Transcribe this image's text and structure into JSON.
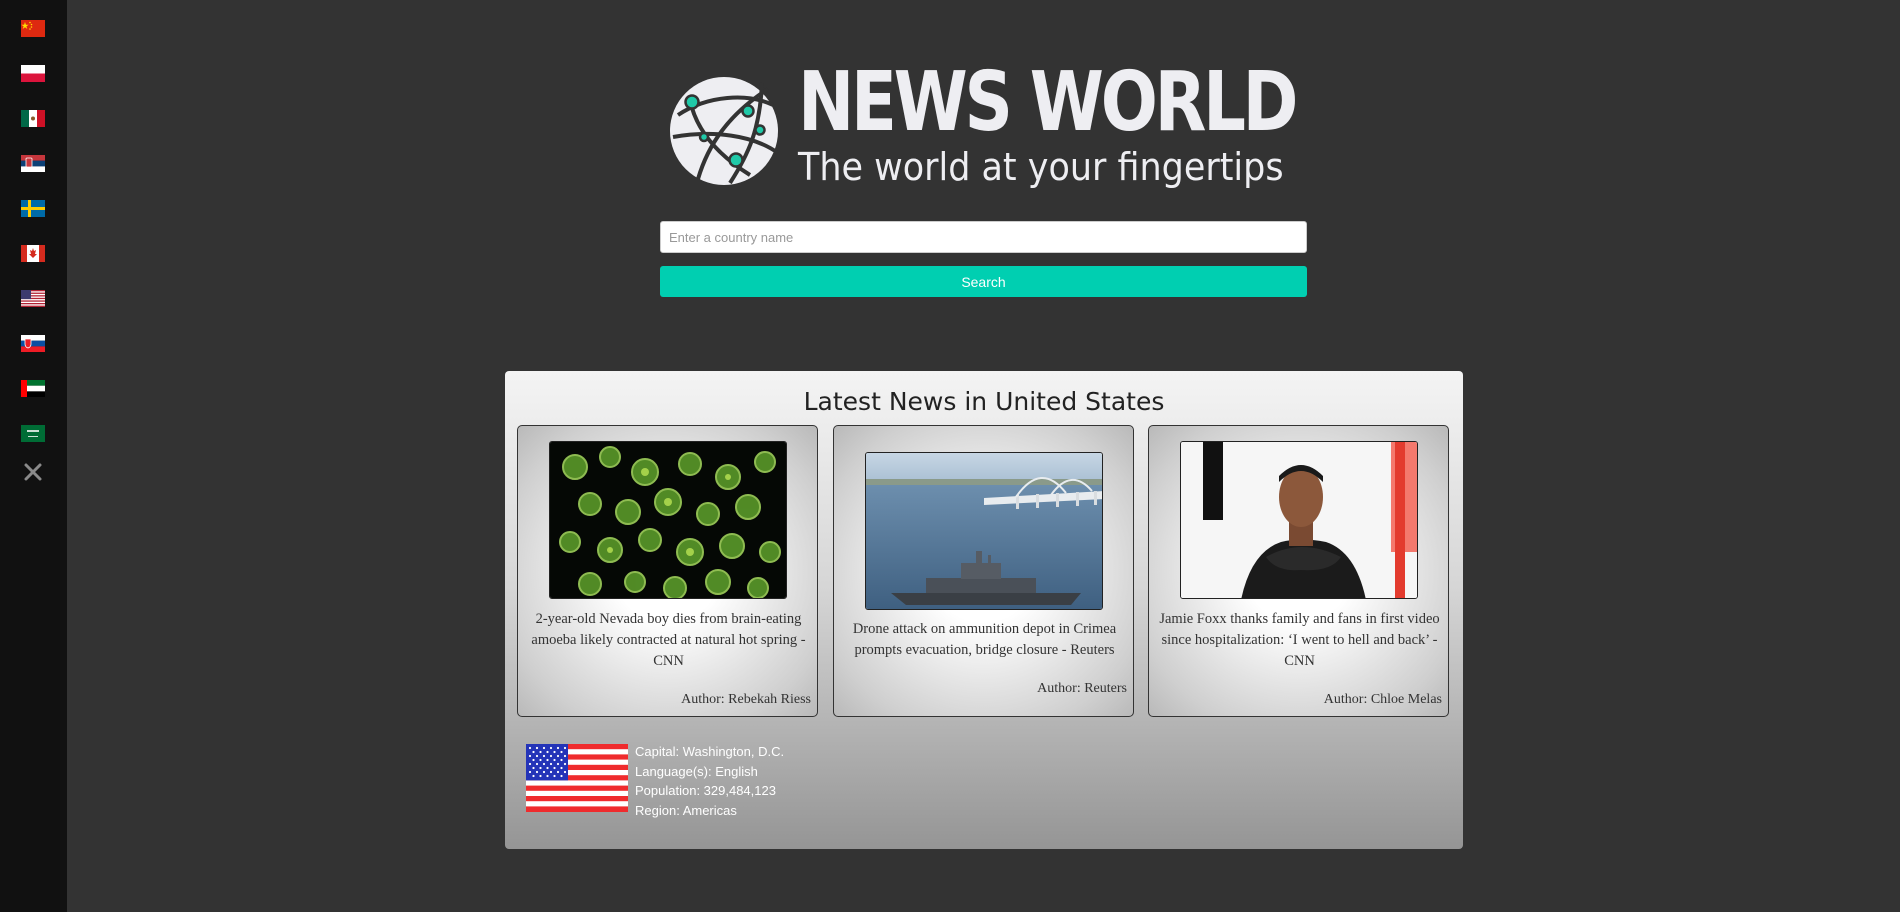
{
  "sidebar": {
    "flags": [
      {
        "icon": "china-flag-icon"
      },
      {
        "icon": "poland-flag-icon"
      },
      {
        "icon": "mexico-flag-icon"
      },
      {
        "icon": "serbia-flag-icon"
      },
      {
        "icon": "sweden-flag-icon"
      },
      {
        "icon": "canada-flag-icon"
      },
      {
        "icon": "usa-flag-icon"
      },
      {
        "icon": "slovakia-flag-icon"
      },
      {
        "icon": "uae-flag-icon"
      },
      {
        "icon": "saudi-arabia-flag-icon"
      }
    ],
    "close_icon": "close-icon"
  },
  "header": {
    "title": "NEWS WORLD",
    "subtitle": "The world at your fingertips",
    "logo_icon": "globe-network-icon"
  },
  "search": {
    "placeholder": "Enter a country name",
    "value": "",
    "button_label": "Search"
  },
  "news": {
    "heading": "Latest News in United States",
    "articles": [
      {
        "title": "2-year-old Nevada boy dies from brain-eating amoeba likely contracted at natural hot spring - CNN",
        "author": "Author: Rebekah Riess"
      },
      {
        "title": "Drone attack on ammunition depot in Crimea prompts evacuation, bridge closure - Reuters",
        "author": "Author: Reuters"
      },
      {
        "title": "Jamie Foxx thanks family and fans in first video since hospitalization: ‘I went to hell and back’ - CNN",
        "author": "Author: Chloe Melas"
      }
    ]
  },
  "country": {
    "flag_icon": "usa-flag-icon",
    "capital": "Capital: Washington, D.C.",
    "languages": "Language(s): English",
    "population": "Population: 329,484,123",
    "region": "Region: Americas"
  },
  "colors": {
    "background": "#333333",
    "sidebar": "#111111",
    "accent": "#00cfb1",
    "logo_text": "#eeeef2"
  }
}
